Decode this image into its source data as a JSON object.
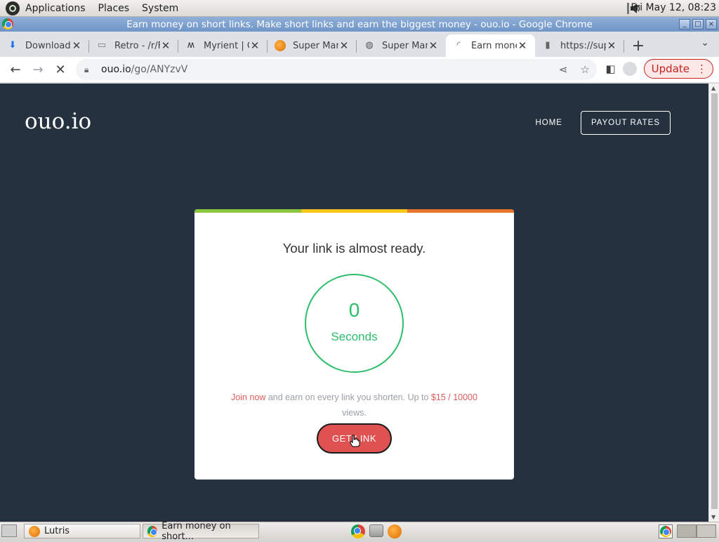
{
  "top_panel": {
    "menus": [
      "Applications",
      "Places",
      "System"
    ],
    "clock": "Fri May 12, 08:23"
  },
  "window": {
    "title": "Earn money on short links. Make short links and earn the biggest money - ouo.io - Google Chrome"
  },
  "tabs": [
    {
      "title": "Downloads",
      "icon": "download-icon"
    },
    {
      "title": "Retro - /r/F",
      "icon": "page-icon"
    },
    {
      "title": "Myrient | C",
      "icon": "myrient-icon"
    },
    {
      "title": "Super Mar",
      "icon": "lutris-icon"
    },
    {
      "title": "Super Mar",
      "icon": "globe-icon"
    },
    {
      "title": "Earn mone",
      "icon": "loading-icon",
      "active": true
    },
    {
      "title": "https://sup",
      "icon": "file-icon"
    }
  ],
  "toolbar": {
    "url_host": "ouo.io",
    "url_path": "/go/ANYzvV",
    "update_label": "Update"
  },
  "site": {
    "logo": "ouo.io",
    "nav_home": "HOME",
    "nav_payout": "PAYOUT RATES"
  },
  "card": {
    "heading": "Your link is almost ready.",
    "countdown_value": "0",
    "countdown_unit": "Seconds",
    "promo_join": "Join now",
    "promo_mid": " and earn on every link you shorten. Up to ",
    "promo_rate": "$15 / 10000",
    "promo_end": " views.",
    "button_label": "GET LINK",
    "bar_colors": [
      "#8cc63f",
      "#f5c518",
      "#e8732a"
    ]
  },
  "taskbar": {
    "tasks": [
      {
        "label": "Lutris"
      },
      {
        "label": "Earn money on short..."
      }
    ]
  },
  "colors": {
    "page_bg": "#26313f",
    "accent_green": "#2ebd6b",
    "accent_red": "#df5252"
  }
}
